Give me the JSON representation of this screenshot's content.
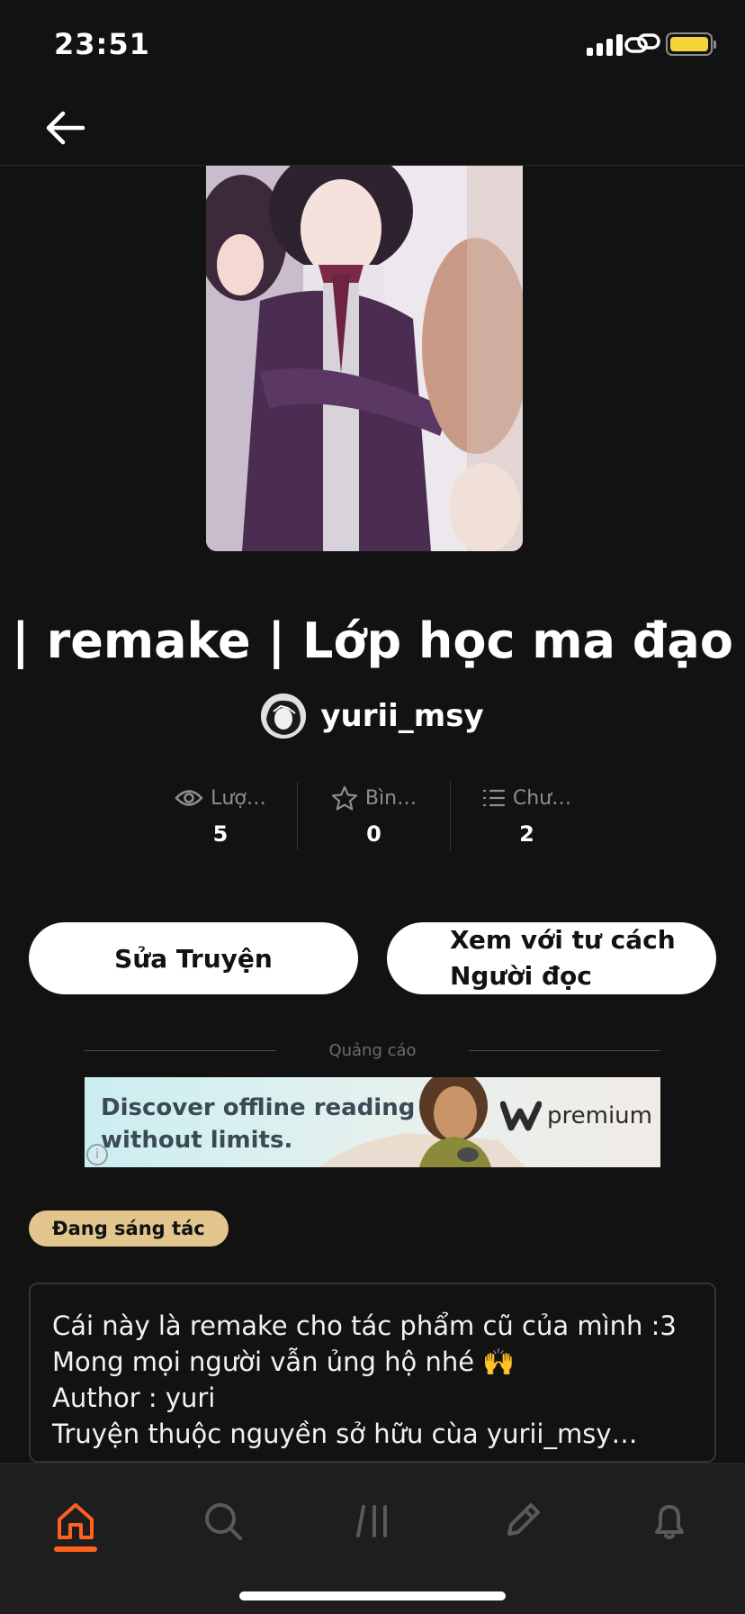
{
  "status_bar": {
    "time": "23:51"
  },
  "story": {
    "title": "| remake | Lớp học ma đạo",
    "author": "yurii_msy"
  },
  "stats": [
    {
      "icon": "eye-icon",
      "label": "Lượ…",
      "value": "5"
    },
    {
      "icon": "star-icon",
      "label": "Bìn…",
      "value": "0"
    },
    {
      "icon": "list-icon",
      "label": "Chư…",
      "value": "2"
    }
  ],
  "actions": {
    "edit_label": "Sửa Truyện",
    "read_line1": "Xem với tư cách",
    "read_line2": "Người đọc"
  },
  "ad": {
    "label": "Quảng cáo",
    "line1": "Discover offline reading",
    "line2": "without limits.",
    "brand": "premium"
  },
  "status_badge": "Đang sáng tác",
  "description": [
    "Cái này là remake cho tác phẩm cũ của mình :3",
    "Mong mọi người vẫn ủng hộ nhé 🙌",
    "Author : yuri",
    "Truyện thuộc nguyền sở hữu cùa yurii_msy…"
  ],
  "nav": [
    "home-icon",
    "search-icon",
    "library-icon",
    "write-icon",
    "bell-icon"
  ],
  "colors": {
    "accent": "#ff5f1f",
    "badge": "#e3c68e",
    "background": "#121212",
    "battery": "#f5d43c"
  }
}
